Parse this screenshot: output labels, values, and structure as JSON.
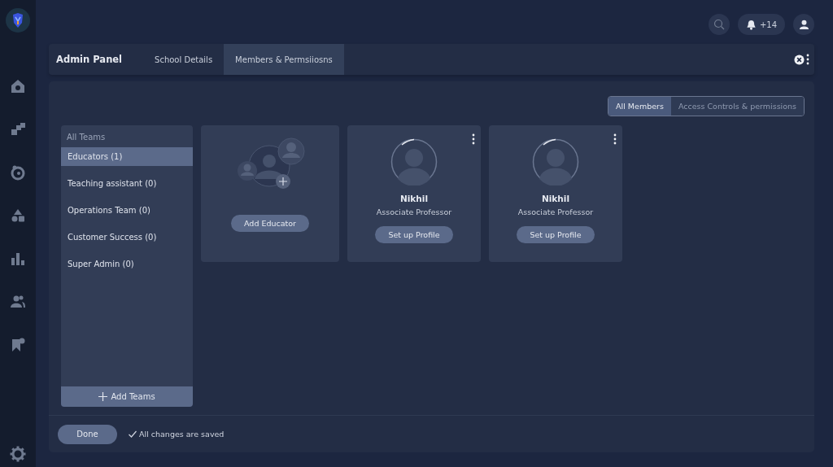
{
  "topbar": {
    "notifications": "+14"
  },
  "header": {
    "title": "Admin Panel",
    "tabs": [
      {
        "label": "School Details",
        "selected": false
      },
      {
        "label": "Members & Permsiiosns",
        "selected": true
      }
    ]
  },
  "view_toggle": [
    {
      "label": "All Members",
      "selected": true
    },
    {
      "label": "Access Controls & permissions",
      "selected": false
    }
  ],
  "teams": {
    "heading": "All Teams",
    "items": [
      {
        "label": "Educators (1)",
        "selected": true
      },
      {
        "label": "Teaching assistant (0)",
        "selected": false
      },
      {
        "label": "Operations Team (0)",
        "selected": false
      },
      {
        "label": "Customer Success (0)",
        "selected": false
      },
      {
        "label": "Super Admin (0)",
        "selected": false
      }
    ],
    "add_button": "Add Teams"
  },
  "cards": [
    {
      "kind": "add",
      "button": "Add Educator"
    },
    {
      "kind": "member",
      "name": "Nikhil",
      "role": "Associate Professor",
      "button": "Set up Profile"
    },
    {
      "kind": "member",
      "name": "Nikhil",
      "role": "Associate Professor",
      "button": "Set up Profile"
    }
  ],
  "footer": {
    "done": "Done",
    "status": "All changes are saved"
  }
}
